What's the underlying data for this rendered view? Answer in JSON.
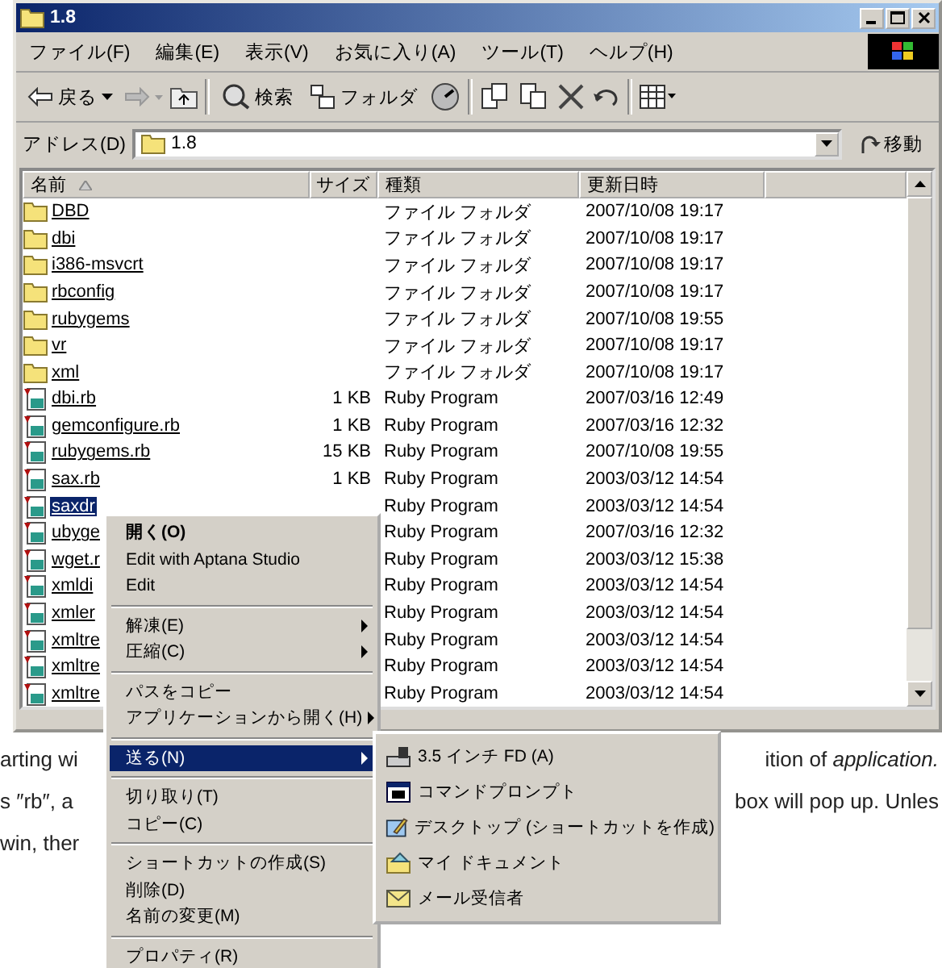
{
  "window": {
    "title": "1.8"
  },
  "menu_bar": [
    "ファイル(F)",
    "編集(E)",
    "表示(V)",
    "お気に入り(A)",
    "ツール(T)",
    "ヘルプ(H)"
  ],
  "toolbar": {
    "back": "戻る",
    "search": "検索",
    "folders": "フォルダ"
  },
  "address": {
    "label": "アドレス(D)",
    "value": "1.8",
    "go": "移動"
  },
  "table": {
    "columns": [
      "名前",
      "サイズ",
      "種類",
      "更新日時"
    ],
    "rows": [
      {
        "kind": "folder",
        "name": "DBD",
        "type": "ファイル フォルダ",
        "modified": "2007/10/08 19:17",
        "selected": false
      },
      {
        "kind": "folder",
        "name": "dbi",
        "type": "ファイル フォルダ",
        "modified": "2007/10/08 19:17",
        "selected": false
      },
      {
        "kind": "folder",
        "name": "i386-msvcrt",
        "type": "ファイル フォルダ",
        "modified": "2007/10/08 19:17",
        "selected": false
      },
      {
        "kind": "folder",
        "name": "rbconfig",
        "type": "ファイル フォルダ",
        "modified": "2007/10/08 19:17",
        "selected": false
      },
      {
        "kind": "folder",
        "name": "rubygems",
        "type": "ファイル フォルダ",
        "modified": "2007/10/08 19:55",
        "selected": false
      },
      {
        "kind": "folder",
        "name": "vr",
        "type": "ファイル フォルダ",
        "modified": "2007/10/08 19:17",
        "selected": false
      },
      {
        "kind": "folder",
        "name": "xml",
        "type": "ファイル フォルダ",
        "modified": "2007/10/08 19:17",
        "selected": false
      },
      {
        "kind": "ruby",
        "name": "dbi.rb",
        "size": "1 KB",
        "type": "Ruby Program",
        "modified": "2007/03/16 12:49",
        "selected": false
      },
      {
        "kind": "ruby",
        "name": "gemconfigure.rb",
        "size": "1 KB",
        "type": "Ruby Program",
        "modified": "2007/03/16 12:32",
        "selected": false
      },
      {
        "kind": "ruby",
        "name": "rubygems.rb",
        "size": "15 KB",
        "type": "Ruby Program",
        "modified": "2007/10/08 19:55",
        "selected": false
      },
      {
        "kind": "ruby",
        "name": "sax.rb",
        "size": "1 KB",
        "type": "Ruby Program",
        "modified": "2003/03/12 14:54",
        "selected": false
      },
      {
        "kind": "ruby",
        "name": "saxdr",
        "type": "Ruby Program",
        "modified": "2003/03/12 14:54",
        "selected": true
      },
      {
        "kind": "ruby",
        "name": "ubyge",
        "type": "Ruby Program",
        "modified": "2007/03/16 12:32",
        "selected": false
      },
      {
        "kind": "ruby",
        "name": "wget.r",
        "type": "Ruby Program",
        "modified": "2003/03/12 15:38",
        "selected": false
      },
      {
        "kind": "ruby",
        "name": "xmldi",
        "type": "Ruby Program",
        "modified": "2003/03/12 14:54",
        "selected": false
      },
      {
        "kind": "ruby",
        "name": "xmler",
        "type": "Ruby Program",
        "modified": "2003/03/12 14:54",
        "selected": false
      },
      {
        "kind": "ruby",
        "name": "xmltre",
        "type": "Ruby Program",
        "modified": "2003/03/12 14:54",
        "selected": false
      },
      {
        "kind": "ruby",
        "name": "xmltre",
        "type": "Ruby Program",
        "modified": "2003/03/12 14:54",
        "selected": false
      },
      {
        "kind": "ruby",
        "name": "xmltre",
        "type": "Ruby Program",
        "modified": "2003/03/12 14:54",
        "selected": false
      }
    ]
  },
  "context_menu": {
    "groups": [
      [
        {
          "label": "開く(O)",
          "default": true,
          "submenu": false,
          "selected": false
        },
        {
          "label": "Edit with Aptana Studio",
          "default": false,
          "submenu": false,
          "selected": false
        },
        {
          "label": "Edit",
          "default": false,
          "submenu": false,
          "selected": false
        }
      ],
      [
        {
          "label": "解凍(E)",
          "default": false,
          "submenu": true,
          "selected": false
        },
        {
          "label": "圧縮(C)",
          "default": false,
          "submenu": true,
          "selected": false
        }
      ],
      [
        {
          "label": "パスをコピー",
          "default": false,
          "submenu": false,
          "selected": false
        },
        {
          "label": "アプリケーションから開く(H)",
          "default": false,
          "submenu": true,
          "selected": false
        }
      ],
      [
        {
          "label": "送る(N)",
          "default": false,
          "submenu": true,
          "selected": true
        }
      ],
      [
        {
          "label": "切り取り(T)",
          "default": false,
          "submenu": false,
          "selected": false
        },
        {
          "label": "コピー(C)",
          "default": false,
          "submenu": false,
          "selected": false
        }
      ],
      [
        {
          "label": "ショートカットの作成(S)",
          "default": false,
          "submenu": false,
          "selected": false
        },
        {
          "label": "削除(D)",
          "default": false,
          "submenu": false,
          "selected": false
        },
        {
          "label": "名前の変更(M)",
          "default": false,
          "submenu": false,
          "selected": false
        }
      ],
      [
        {
          "label": "プロパティ(R)",
          "default": false,
          "submenu": false,
          "selected": false
        }
      ]
    ]
  },
  "send_to_menu": [
    {
      "kind": "floppy",
      "label": "3.5 インチ FD (A)"
    },
    {
      "kind": "console",
      "label": "コマンドプロンプト"
    },
    {
      "kind": "desktop",
      "label": "デスクトップ (ショートカットを作成)"
    },
    {
      "kind": "documents",
      "label": "マイ ドキュメント"
    },
    {
      "kind": "mail",
      "label": "メール受信者"
    }
  ],
  "background_text": [
    {
      "left": "arting wi",
      "right": "ition of *application.*"
    },
    {
      "left": "s ″rb″, a",
      "right": "box will pop up. Unles"
    },
    {
      "left": "win, ther"
    }
  ]
}
